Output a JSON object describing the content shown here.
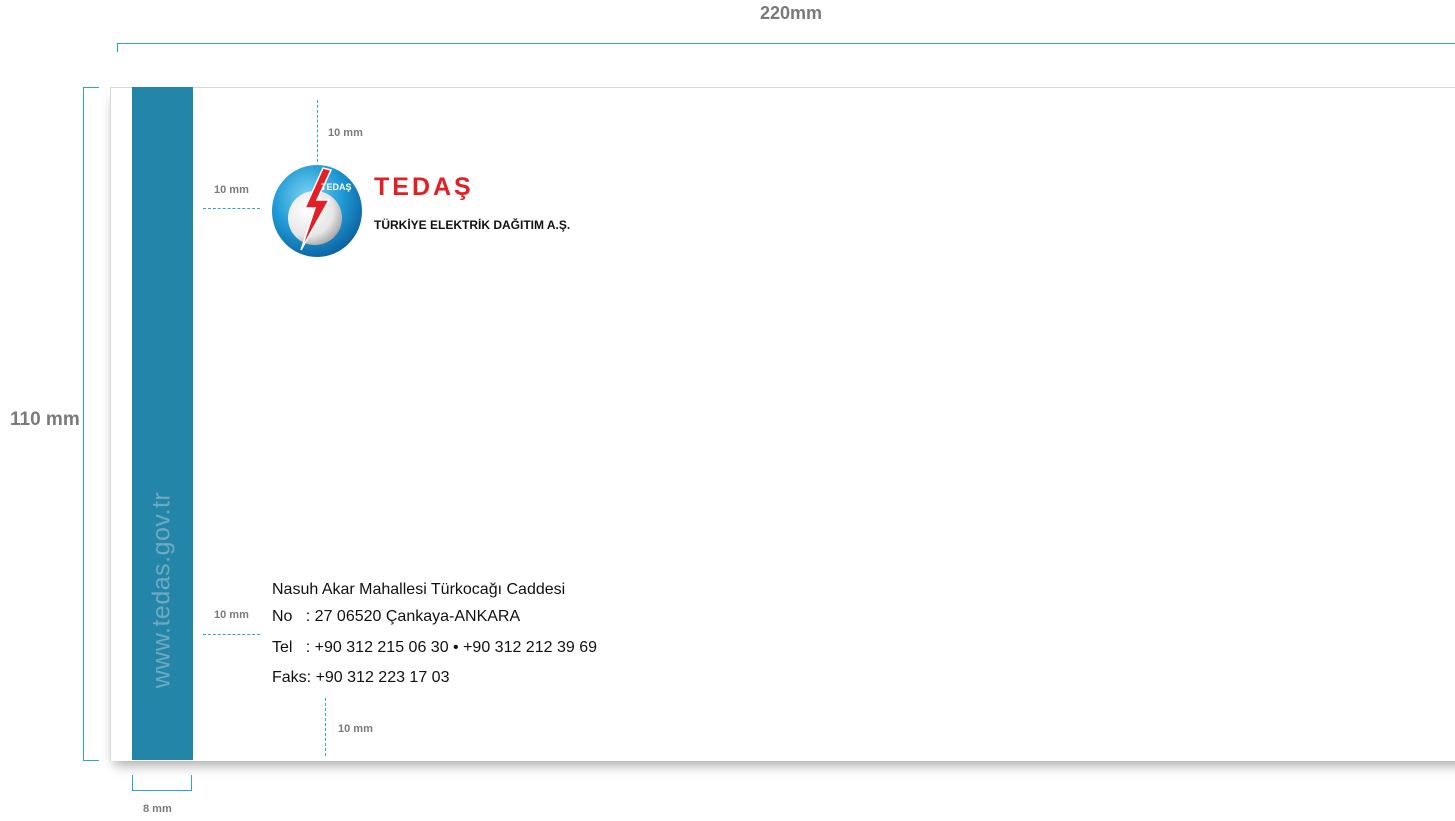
{
  "dimensions": {
    "width_label": "220mm",
    "height_label": "110 mm",
    "stripe_width_label": "8 mm",
    "margin_top_label": "10 mm",
    "margin_left_logo_label": "10 mm",
    "margin_left_address_label": "10 mm",
    "margin_bottom_label": "10 mm"
  },
  "colors": {
    "stripe": "#2385a8",
    "brand_red": "#e31e24",
    "guide_cyan": "#2aa6cf",
    "dimension_gray": "#7a7a7a"
  },
  "stripe": {
    "website": "www.tedas.gov.tr"
  },
  "logo": {
    "emblem_text": "TEDAŞ",
    "brand_name": "TEDAŞ",
    "brand_subtitle": "TÜRKİYE ELEKTRİK DAĞITIM A.Ş."
  },
  "address": {
    "line1": "Nasuh Akar Mahallesi Türkocağı Caddesi",
    "line2": "No   : 27 06520 Çankaya-ANKARA",
    "line3": "Tel   : +90 312 215 06 30 • +90 312 212 39 69",
    "line4": "Faks: +90 312 223 17 03"
  }
}
